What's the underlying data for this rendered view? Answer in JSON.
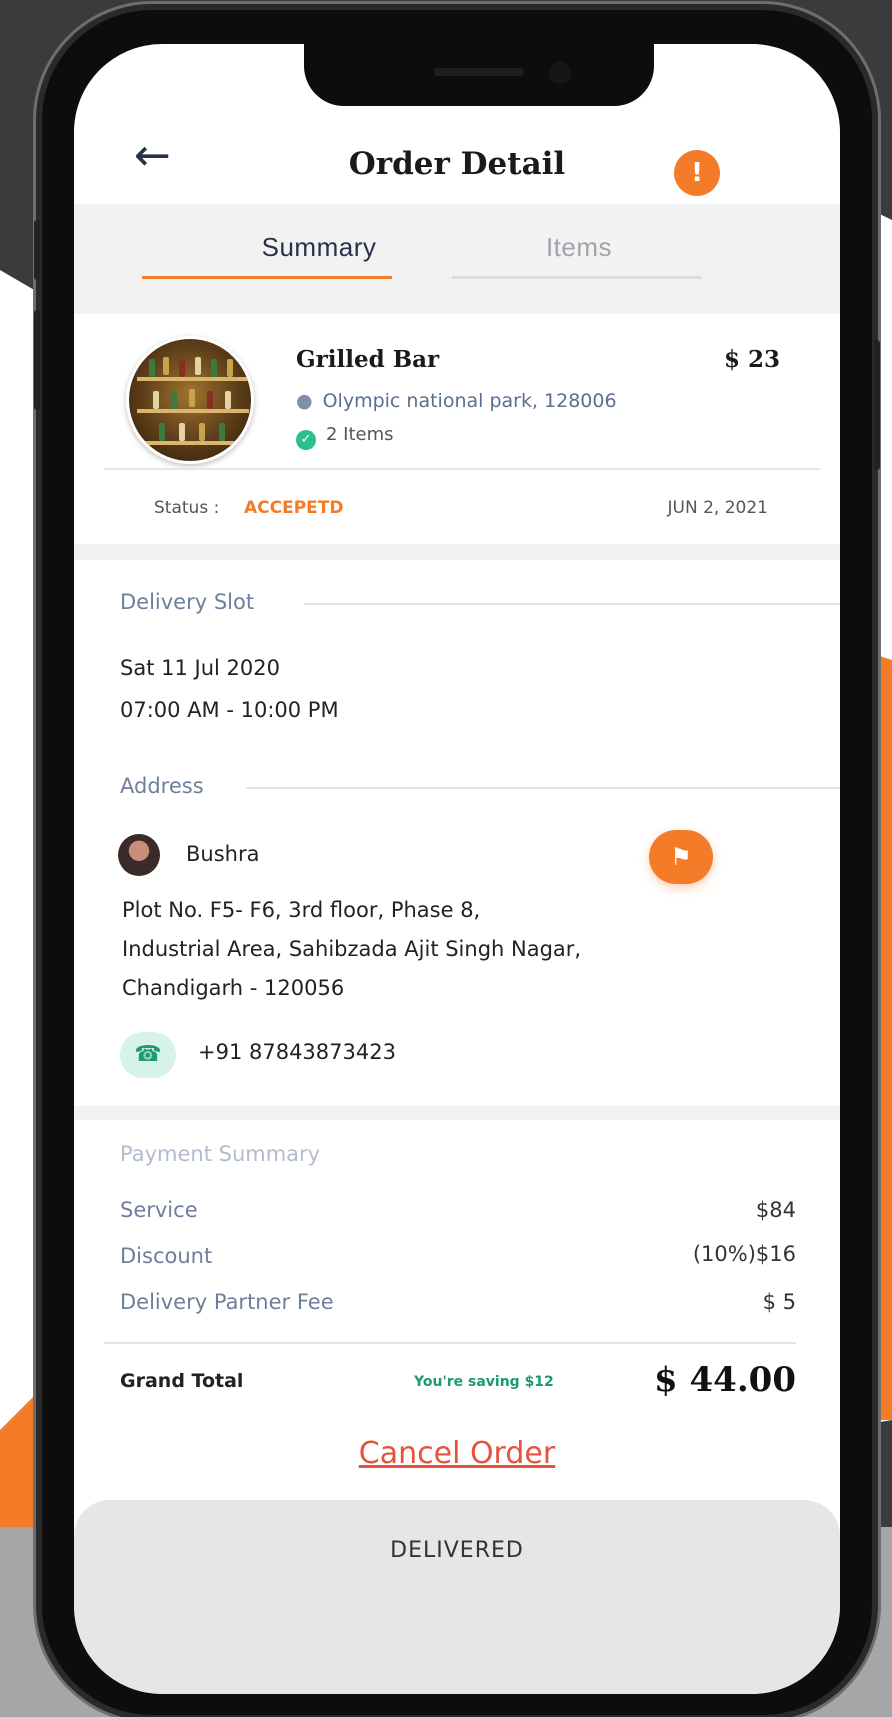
{
  "header": {
    "title": "Order Detail",
    "back_icon": "←",
    "alert_icon": "!"
  },
  "tabs": [
    {
      "label": "Summary",
      "active": true
    },
    {
      "label": "Items",
      "active": false
    }
  ],
  "order": {
    "store_name": "Grilled Bar",
    "price": "$ 23",
    "location": "Olympic national park, 128006",
    "items_count": "2 Items",
    "status_label": "Status :",
    "status_value": "ACCEPETD",
    "date": "JUN 2, 2021"
  },
  "delivery": {
    "section_label": "Delivery Slot",
    "date": "Sat 11 Jul 2020",
    "time": "07:00 AM - 10:00 PM"
  },
  "address": {
    "section_label": "Address",
    "name": "Bushra",
    "line1": "Plot No. F5- F6, 3rd floor, Phase 8,",
    "line2": "Industrial Area, Sahibzada Ajit Singh Nagar,",
    "line3": "Chandigarh - 120056",
    "phone": "+91 87843873423"
  },
  "payment": {
    "title": "Payment Summary",
    "rows": [
      {
        "label": "Service",
        "value": "$84"
      },
      {
        "label": "Discount",
        "value": "(10%)$16"
      },
      {
        "label": "Delivery Partner Fee",
        "value": "$ 5"
      }
    ],
    "grand_total_label": "Grand Total",
    "saving_text": "You're saving $12",
    "grand_total_value": "$ 44.00"
  },
  "actions": {
    "cancel_label": "Cancel Order",
    "bottom_label": "DELIVERED"
  },
  "colors": {
    "accent": "#f47b28",
    "success": "#2bbf8e",
    "danger": "#e5533d",
    "label": "#6d7f9c"
  }
}
